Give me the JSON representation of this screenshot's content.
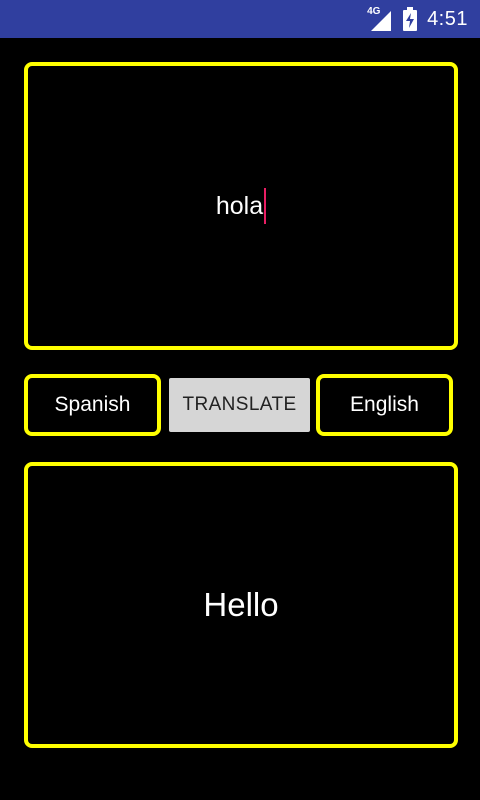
{
  "status_bar": {
    "network_label": "4G",
    "time": "4:51",
    "icons": [
      "signal-icon",
      "battery-charging-icon"
    ],
    "color": "#303f9f"
  },
  "input": {
    "value": "hola"
  },
  "source_language": {
    "label": "Spanish"
  },
  "translate_button": {
    "label": "TRANSLATE"
  },
  "target_language": {
    "label": "English"
  },
  "output": {
    "value": "Hello"
  },
  "colors": {
    "border": "#ffff00",
    "background": "#000000",
    "cursor": "#e91e63",
    "button": "#d6d6d6"
  }
}
